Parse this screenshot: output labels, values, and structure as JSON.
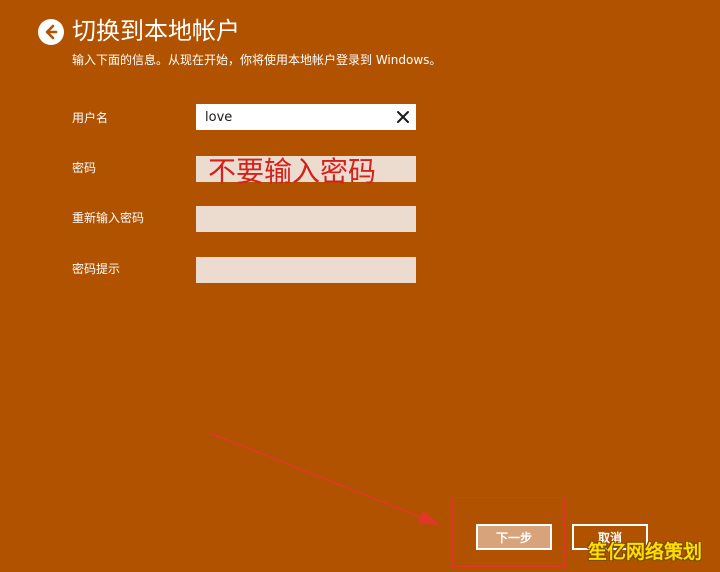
{
  "header": {
    "title": "切换到本地帐户",
    "instructions": "输入下面的信息。从现在开始，你将使用本地帐户登录到 Windows。"
  },
  "form": {
    "username_label": "用户名",
    "username_value": "love",
    "password_label": "密码",
    "password_confirm_label": "重新输入密码",
    "password_hint_label": "密码提示"
  },
  "annotation": {
    "text": "不要输入密码",
    "color": "#d6201a"
  },
  "buttons": {
    "next_label": "下一步",
    "cancel_label": "取消"
  },
  "watermark": {
    "text": "笙亿网络策划"
  },
  "colors": {
    "background": "#b05200",
    "field_empty": "#ecdccf",
    "next_button": "#d6a37a",
    "highlight": "#e2362c"
  },
  "icons": {
    "back": "back-arrow-circle-icon",
    "clear": "close-icon"
  }
}
